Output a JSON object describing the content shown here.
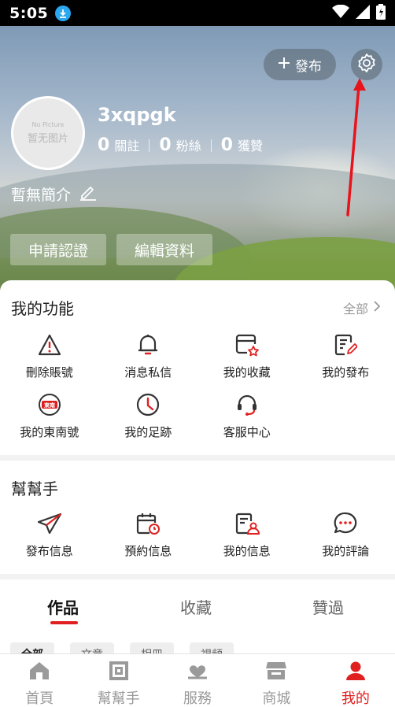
{
  "status_bar": {
    "time": "5:05"
  },
  "header": {
    "publish_label": "發布",
    "username": "3xqpgk",
    "avatar_en": "No Picture",
    "avatar_zh": "暂无图片",
    "stats": [
      {
        "num": "0",
        "label": "關註"
      },
      {
        "num": "0",
        "label": "粉絲"
      },
      {
        "num": "0",
        "label": "獲贊"
      }
    ],
    "bio": "暫無簡介",
    "cert_button": "申請認證",
    "edit_button": "編輯資料"
  },
  "functions": {
    "title": "我的功能",
    "more": "全部",
    "items": [
      {
        "label": "刪除賬號",
        "icon": "warning-icon"
      },
      {
        "label": "消息私信",
        "icon": "bell-icon"
      },
      {
        "label": "我的收藏",
        "icon": "favorites-icon"
      },
      {
        "label": "我的發布",
        "icon": "publish-edit-icon"
      },
      {
        "label": "我的東南號",
        "icon": "dongnan-icon",
        "badge": "東南"
      },
      {
        "label": "我的足跡",
        "icon": "clock-icon"
      },
      {
        "label": "客服中心",
        "icon": "headset-icon"
      }
    ]
  },
  "helper": {
    "title": "幫幫手",
    "items": [
      {
        "label": "發布信息",
        "icon": "send-icon"
      },
      {
        "label": "預約信息",
        "icon": "calendar-icon"
      },
      {
        "label": "我的信息",
        "icon": "profile-doc-icon"
      },
      {
        "label": "我的評論",
        "icon": "comment-icon"
      }
    ]
  },
  "content_tabs": {
    "tabs": [
      "作品",
      "收藏",
      "贊過"
    ],
    "filters": [
      "全部",
      "文章",
      "相冊",
      "視頻"
    ]
  },
  "bottom_nav": {
    "items": [
      {
        "label": "首頁",
        "icon": "home-icon"
      },
      {
        "label": "幫幫手",
        "icon": "helper-icon"
      },
      {
        "label": "服務",
        "icon": "service-icon"
      },
      {
        "label": "商城",
        "icon": "shop-icon"
      },
      {
        "label": "我的",
        "icon": "user-icon"
      }
    ]
  },
  "colors": {
    "accent": "#e02020",
    "icon_dark": "#333333"
  }
}
